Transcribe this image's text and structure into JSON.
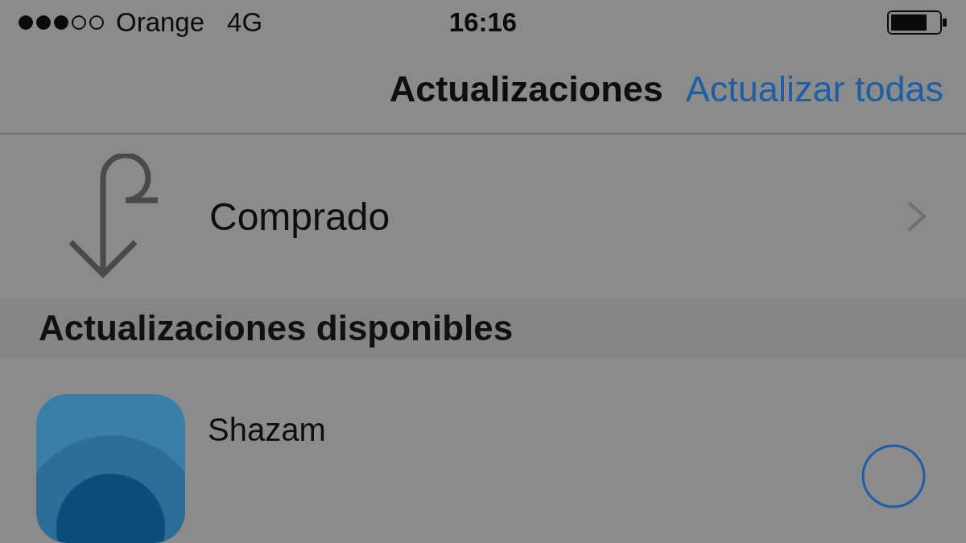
{
  "status_bar": {
    "carrier": "Orange",
    "network": "4G",
    "time": "16:16"
  },
  "nav_bar": {
    "title": "Actualizaciones",
    "action": "Actualizar todas"
  },
  "purchased_row": {
    "label": "Comprado"
  },
  "section_header": {
    "title": "Actualizaciones disponibles"
  },
  "apps": [
    {
      "name": "Shazam"
    }
  ]
}
